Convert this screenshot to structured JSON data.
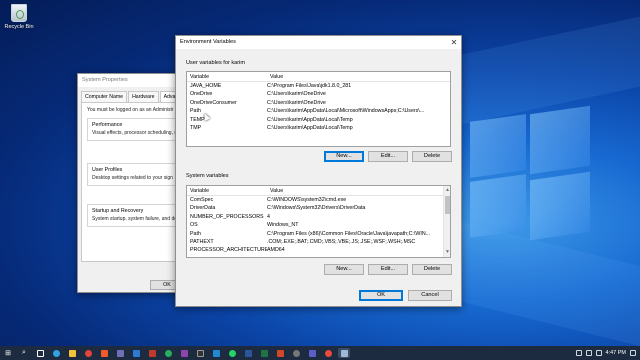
{
  "desktop": {
    "recycle_bin_label": "Recycle Bin"
  },
  "system_properties": {
    "title": "System Properties",
    "tabs": [
      "Computer Name",
      "Hardware",
      "Advanced"
    ],
    "notice": "You must be logged on as an Administr",
    "groups": [
      {
        "title": "Performance",
        "text": "Visual effects, processor scheduling, m"
      },
      {
        "title": "User Profiles",
        "text": "Desktop settings related to your sign"
      },
      {
        "title": "Startup and Recovery",
        "text": "System startup, system failure, and deb"
      }
    ],
    "ok_label": "OK"
  },
  "env_vars": {
    "title": "Environment Variables",
    "close_glyph": "✕",
    "user_section_label": "User variables for karim",
    "system_section_label": "System variables",
    "col_variable": "Variable",
    "col_value": "Value",
    "user_rows": [
      {
        "name": "JAVA_HOME",
        "value": "C:\\Program Files\\Java\\jdk1.8.0_281"
      },
      {
        "name": "OneDrive",
        "value": "C:\\Users\\karim\\OneDrive"
      },
      {
        "name": "OneDriveConsumer",
        "value": "C:\\Users\\karim\\OneDrive"
      },
      {
        "name": "Path",
        "value": "C:\\Users\\karim\\AppData\\Local\\Microsoft\\WindowsApps;C:\\Users\\..."
      },
      {
        "name": "TEMP",
        "value": "C:\\Users\\karim\\AppData\\Local\\Temp"
      },
      {
        "name": "TMP",
        "value": "C:\\Users\\karim\\AppData\\Local\\Temp"
      }
    ],
    "system_rows": [
      {
        "name": "ComSpec",
        "value": "C:\\WINDOWS\\system32\\cmd.exe"
      },
      {
        "name": "DriverData",
        "value": "C:\\Windows\\System32\\Drivers\\DriverData"
      },
      {
        "name": "NUMBER_OF_PROCESSORS",
        "value": "4"
      },
      {
        "name": "OS",
        "value": "Windows_NT"
      },
      {
        "name": "Path",
        "value": "C:\\Program Files (x86)\\Common Files\\Oracle\\Java\\javapath;C:\\WIN..."
      },
      {
        "name": "PATHEXT",
        "value": ".COM;.EXE;.BAT;.CMD;.VBS;.VBE;.JS;.JSE;.WSF;.WSH;.MSC"
      },
      {
        "name": "PROCESSOR_ARCHITECTURE",
        "value": "AMD64"
      }
    ],
    "buttons": {
      "new": "New...",
      "edit": "Edit...",
      "delete": "Delete",
      "ok": "OK",
      "cancel": "Cancel"
    }
  },
  "taskbar": {
    "clock": "4:47 PM",
    "start_glyph": "⊞",
    "search_glyph": "⌕"
  },
  "colors": {
    "selection": "#cce8ff",
    "accent": "#0078d7",
    "taskbar": "#1c2b3f"
  }
}
